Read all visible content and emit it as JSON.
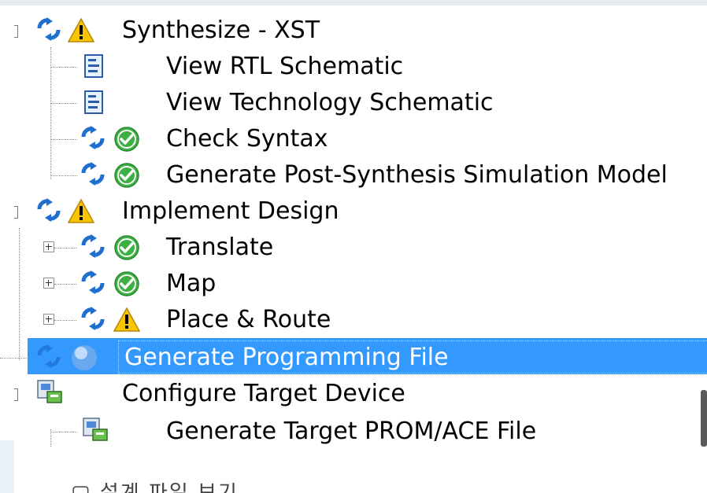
{
  "process_tree": {
    "rows": [
      {
        "label": "Synthesize - XST",
        "status": "warning"
      },
      {
        "label": "View RTL Schematic",
        "status": "none"
      },
      {
        "label": "View Technology Schematic",
        "status": "none"
      },
      {
        "label": "Check Syntax",
        "status": "ok"
      },
      {
        "label": "Generate Post-Synthesis Simulation Model",
        "status": "ok"
      },
      {
        "label": "Implement Design",
        "status": "warning"
      },
      {
        "label": "Translate",
        "status": "ok"
      },
      {
        "label": "Map",
        "status": "ok"
      },
      {
        "label": "Place & Route",
        "status": "warning"
      },
      {
        "label": "Generate Programming File",
        "status": "pending",
        "selected": true
      },
      {
        "label": "Configure Target Device",
        "status": "none"
      },
      {
        "label": "Generate Target PROM/ACE File",
        "status": "none"
      }
    ]
  },
  "colors": {
    "selection": "#3399ff",
    "ok_green": "#3cb043",
    "warning_yellow": "#f7c600",
    "rerun_blue": "#1f6fd1"
  },
  "icons": {
    "rerun": "rerun-arrows-icon",
    "warning": "warning-icon",
    "ok": "check-circle-icon",
    "pending": "globe-icon",
    "schematic_rtl": "schematic-icon",
    "schematic_tech": "schematic-icon",
    "configure": "device-config-icon"
  },
  "partial_footer_text": "▢ 설계 파일 보기"
}
